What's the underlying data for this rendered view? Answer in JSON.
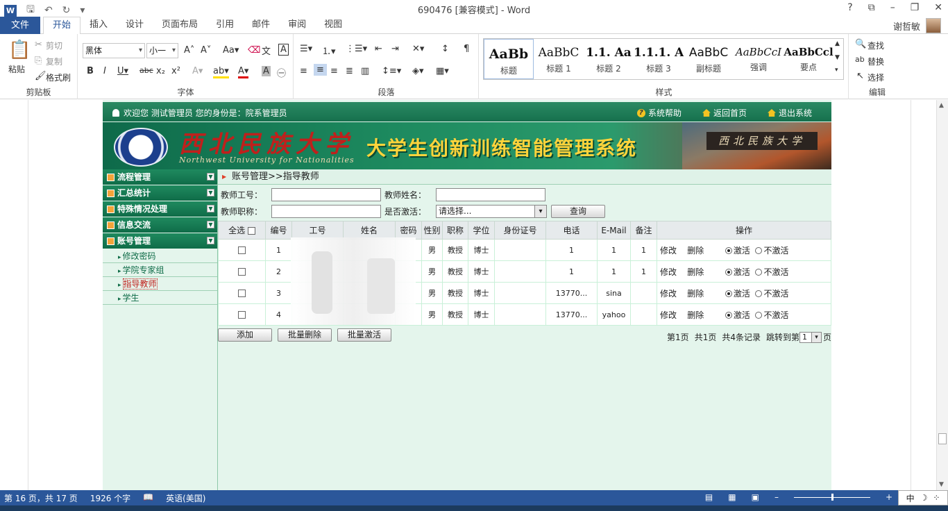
{
  "word": {
    "title": "690476 [兼容模式] - Word",
    "tabs": [
      "文件",
      "开始",
      "插入",
      "设计",
      "页面布局",
      "引用",
      "邮件",
      "审阅",
      "视图"
    ],
    "active_tab": "开始",
    "user_name": "谢哲敏",
    "clipboard": {
      "paste": "粘贴",
      "cut": "剪切",
      "copy": "复制",
      "format_painter": "格式刷",
      "label": "剪贴板"
    },
    "font": {
      "name": "黑体",
      "size": "小一",
      "label": "字体"
    },
    "paragraph_label": "段落",
    "styles": {
      "label": "样式",
      "items": [
        {
          "sample": "AaBb",
          "name": "标题"
        },
        {
          "sample": "AaBbC",
          "name": "标题 1"
        },
        {
          "sample": "1.1. Aa",
          "name": "标题 2"
        },
        {
          "sample": "1.1.1. A",
          "name": "标题 3"
        },
        {
          "sample": "AaBbC",
          "name": "副标题"
        },
        {
          "sample": "AaBbCcI",
          "name": "强调"
        },
        {
          "sample": "AaBbCcl",
          "name": "要点"
        }
      ]
    },
    "editing": {
      "find": "查找",
      "replace": "替换",
      "select": "选择",
      "label": "编辑"
    },
    "status": {
      "page": "第 16 页，共 17 页",
      "words": "1926 个字",
      "language": "英语(美国)"
    },
    "ime": "中"
  },
  "app": {
    "welcome": "欢迎您  测试管理员  您的身份是：院系管理员",
    "top_links": {
      "help": "系统帮助",
      "home": "返回首页",
      "logout": "退出系统"
    },
    "banner": {
      "school_cn": "西北民族大学",
      "school_en": "Northwest University for Nationalities",
      "system_name": "大学生创新训练智能管理系统",
      "gate_text": "西北民族大学"
    },
    "menu": [
      {
        "label": "流程管理"
      },
      {
        "label": "汇总统计"
      },
      {
        "label": "特殊情况处理"
      },
      {
        "label": "信息交流"
      },
      {
        "label": "账号管理"
      }
    ],
    "submenu": [
      "修改密码",
      "学院专家组",
      "指导教师",
      "学生"
    ],
    "breadcrumb": "账号管理>>指导教师",
    "filters": {
      "teacher_id_label": "教师工号：",
      "teacher_name_label": "教师姓名：",
      "teacher_title_label": "教师职称：",
      "active_label": "是否激活：",
      "active_value": "请选择...",
      "query_button": "查询"
    },
    "table": {
      "headers": [
        "全选",
        "编号",
        "工号",
        "姓名",
        "密码",
        "性别",
        "职称",
        "学位",
        "身份证号",
        "电话",
        "E-Mail",
        "备注",
        "操作"
      ],
      "rows": [
        {
          "no": "1",
          "gender": "男",
          "title": "教授",
          "degree": "博士",
          "phone": "1",
          "email": "1",
          "note": "1"
        },
        {
          "no": "2",
          "gender": "男",
          "title": "教授",
          "degree": "博士",
          "phone": "1",
          "email": "1",
          "note": "1"
        },
        {
          "no": "3",
          "gender": "男",
          "title": "教授",
          "degree": "博士",
          "phone": "13770...",
          "email": "sina",
          "note": ""
        },
        {
          "no": "4",
          "gender": "男",
          "title": "教授",
          "degree": "博士",
          "phone": "13770...",
          "email": "yahoo",
          "note": ""
        }
      ],
      "actions": {
        "edit": "修改",
        "delete": "删除",
        "active": "激活",
        "inactive": "不激活"
      }
    },
    "bottom_buttons": {
      "add": "添加",
      "batch_delete": "批量删除",
      "batch_activate": "批量激活"
    },
    "pager": {
      "page": "第1页",
      "total_pages": "共1页",
      "records": "共4条记录",
      "jump": "跳转到第",
      "current": "1",
      "suffix": "页"
    }
  }
}
